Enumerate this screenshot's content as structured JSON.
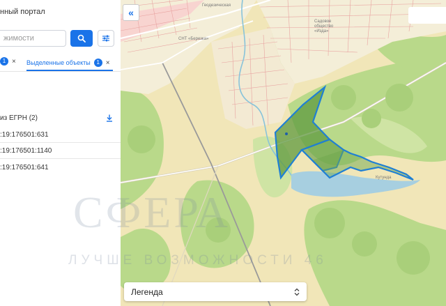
{
  "panel": {
    "portal_title": "нный портал",
    "search": {
      "placeholder": "жимости",
      "button_icon": "search-icon",
      "filter_icon": "filter-sliders-icon"
    },
    "tabs": [
      {
        "label": "",
        "count": "1",
        "close": "×"
      },
      {
        "label": "Выделенные объекты",
        "count": "1",
        "close": "×"
      }
    ],
    "egrn": {
      "title": "из ЕГРН (2)",
      "download_icon": "download-icon",
      "parcels": [
        ":19:176501:631",
        ":19:176501:1140",
        ":19:176501:641"
      ]
    }
  },
  "map": {
    "collapse_icon": "double-chevron-left-icon",
    "collapse_symbol": "«",
    "legend": {
      "label": "Легенда",
      "chevron_icon": "chevron-updown-icon"
    },
    "labels": {
      "street_1": "Геодезическая",
      "snt_1": "Садовое общество «Изда»",
      "snt_2": "СНТ «Березка»",
      "lake": "Кутунда"
    },
    "watermark": {
      "main": "СФЕРА",
      "sub": "ЛУЧШЕ ВОЗМОЖНОСТИ 46"
    },
    "colors": {
      "selection_outline": "#1f7fd4",
      "selection_fill": "#5f9a3f",
      "forest": "#b9d98a",
      "field": "#f1e6b8",
      "water": "#a7cfe0"
    }
  }
}
